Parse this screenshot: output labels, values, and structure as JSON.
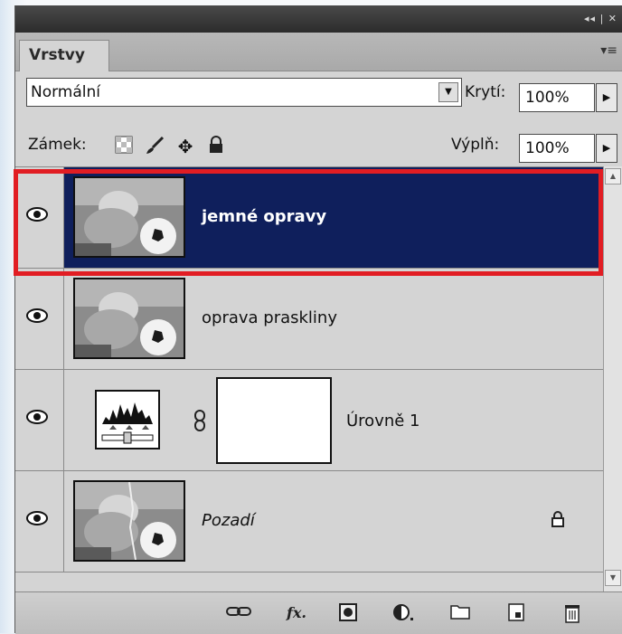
{
  "panel": {
    "tab_label": "Vrstvy",
    "titlebar_controls": "◂◂ | ✕"
  },
  "blend": {
    "mode": "Normální",
    "opacity_label": "Krytí:",
    "opacity_value": "100%"
  },
  "lock": {
    "label": "Zámek:",
    "icons": [
      "lock-transparent-icon",
      "lock-paint-icon",
      "lock-position-icon",
      "lock-all-icon"
    ],
    "fill_label": "Výplň:",
    "fill_value": "100%"
  },
  "layers": [
    {
      "name": "jemné opravy",
      "selected": true,
      "visible": true,
      "thumb": "photo"
    },
    {
      "name": "oprava praskliny",
      "selected": false,
      "visible": true,
      "thumb": "photo"
    },
    {
      "name": "Úrovně 1",
      "selected": false,
      "visible": true,
      "thumb": "adjustment-levels"
    },
    {
      "name": "Pozadí",
      "selected": false,
      "visible": true,
      "thumb": "photo",
      "locked": true
    }
  ],
  "bottom_icons": [
    "link-layers-icon",
    "fx-icon",
    "add-mask-icon",
    "adjustment-layer-icon",
    "new-group-icon",
    "new-layer-icon",
    "delete-layer-icon"
  ],
  "colors": {
    "selection": "#0f1f5c",
    "highlight_box": "#e11d23",
    "panel_bg": "#d4d4d4"
  }
}
